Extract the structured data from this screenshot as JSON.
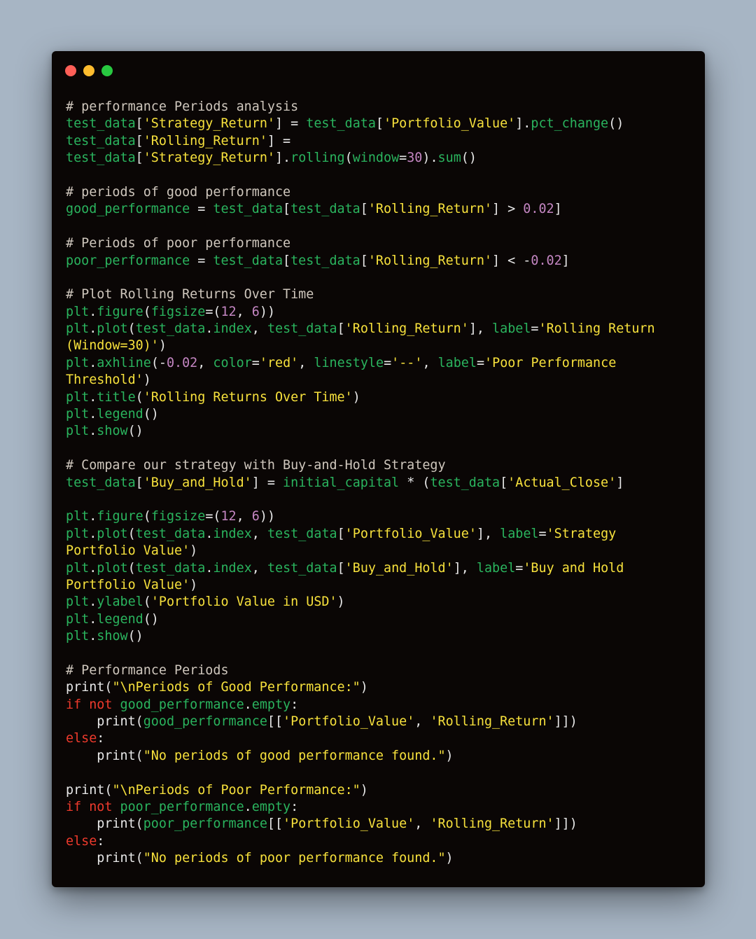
{
  "window": {
    "controls": [
      {
        "name": "close",
        "color": "#ff5f57"
      },
      {
        "name": "minimize",
        "color": "#febc2e"
      },
      {
        "name": "maximize",
        "color": "#28c840"
      }
    ]
  },
  "colors": {
    "background": "#a7b5c4",
    "editor_background": "#0a0605",
    "comment": "#cfc7bd",
    "identifier": "#2ab45e",
    "string": "#f7e13c",
    "number": "#c486c2",
    "keyword": "#ee3a2c",
    "plain": "#e8e8e8"
  },
  "code_lines": [
    [
      [
        "comment",
        "# performance Periods analysis"
      ]
    ],
    [
      [
        "ident",
        "test_data"
      ],
      [
        "plain",
        "["
      ],
      [
        "string",
        "'Strategy_Return'"
      ],
      [
        "plain",
        "] = "
      ],
      [
        "ident",
        "test_data"
      ],
      [
        "plain",
        "["
      ],
      [
        "string",
        "'Portfolio_Value'"
      ],
      [
        "plain",
        "]."
      ],
      [
        "ident",
        "pct_change"
      ],
      [
        "plain",
        "()"
      ]
    ],
    [
      [
        "ident",
        "test_data"
      ],
      [
        "plain",
        "["
      ],
      [
        "string",
        "'Rolling_Return'"
      ],
      [
        "plain",
        "] ="
      ]
    ],
    [
      [
        "ident",
        "test_data"
      ],
      [
        "plain",
        "["
      ],
      [
        "string",
        "'Strategy_Return'"
      ],
      [
        "plain",
        "]."
      ],
      [
        "ident",
        "rolling"
      ],
      [
        "plain",
        "("
      ],
      [
        "ident",
        "window"
      ],
      [
        "plain",
        "="
      ],
      [
        "number",
        "30"
      ],
      [
        "plain",
        ")."
      ],
      [
        "ident",
        "sum"
      ],
      [
        "plain",
        "()"
      ]
    ],
    [],
    [
      [
        "comment",
        "# periods of good performance"
      ]
    ],
    [
      [
        "ident",
        "good_performance"
      ],
      [
        "plain",
        " = "
      ],
      [
        "ident",
        "test_data"
      ],
      [
        "plain",
        "["
      ],
      [
        "ident",
        "test_data"
      ],
      [
        "plain",
        "["
      ],
      [
        "string",
        "'Rolling_Return'"
      ],
      [
        "plain",
        "] > "
      ],
      [
        "number",
        "0.02"
      ],
      [
        "plain",
        "]"
      ]
    ],
    [],
    [
      [
        "comment",
        "# Periods of poor performance"
      ]
    ],
    [
      [
        "ident",
        "poor_performance"
      ],
      [
        "plain",
        " = "
      ],
      [
        "ident",
        "test_data"
      ],
      [
        "plain",
        "["
      ],
      [
        "ident",
        "test_data"
      ],
      [
        "plain",
        "["
      ],
      [
        "string",
        "'Rolling_Return'"
      ],
      [
        "plain",
        "] < -"
      ],
      [
        "number",
        "0.02"
      ],
      [
        "plain",
        "]"
      ]
    ],
    [],
    [
      [
        "comment",
        "# Plot Rolling Returns Over Time"
      ]
    ],
    [
      [
        "ident",
        "plt"
      ],
      [
        "plain",
        "."
      ],
      [
        "ident",
        "figure"
      ],
      [
        "plain",
        "("
      ],
      [
        "ident",
        "figsize"
      ],
      [
        "plain",
        "=("
      ],
      [
        "number",
        "12"
      ],
      [
        "plain",
        ", "
      ],
      [
        "number",
        "6"
      ],
      [
        "plain",
        "))"
      ]
    ],
    [
      [
        "ident",
        "plt"
      ],
      [
        "plain",
        "."
      ],
      [
        "ident",
        "plot"
      ],
      [
        "plain",
        "("
      ],
      [
        "ident",
        "test_data"
      ],
      [
        "plain",
        "."
      ],
      [
        "ident",
        "index"
      ],
      [
        "plain",
        ", "
      ],
      [
        "ident",
        "test_data"
      ],
      [
        "plain",
        "["
      ],
      [
        "string",
        "'Rolling_Return'"
      ],
      [
        "plain",
        "], "
      ],
      [
        "ident",
        "label"
      ],
      [
        "plain",
        "="
      ],
      [
        "string",
        "'Rolling Return"
      ]
    ],
    [
      [
        "string",
        "(Window=30)'"
      ],
      [
        "plain",
        ")"
      ]
    ],
    [
      [
        "ident",
        "plt"
      ],
      [
        "plain",
        "."
      ],
      [
        "ident",
        "axhline"
      ],
      [
        "plain",
        "(-"
      ],
      [
        "number",
        "0.02"
      ],
      [
        "plain",
        ", "
      ],
      [
        "ident",
        "color"
      ],
      [
        "plain",
        "="
      ],
      [
        "string",
        "'red'"
      ],
      [
        "plain",
        ", "
      ],
      [
        "ident",
        "linestyle"
      ],
      [
        "plain",
        "="
      ],
      [
        "string",
        "'--'"
      ],
      [
        "plain",
        ", "
      ],
      [
        "ident",
        "label"
      ],
      [
        "plain",
        "="
      ],
      [
        "string",
        "'Poor Performance"
      ]
    ],
    [
      [
        "string",
        "Threshold'"
      ],
      [
        "plain",
        ")"
      ]
    ],
    [
      [
        "ident",
        "plt"
      ],
      [
        "plain",
        "."
      ],
      [
        "ident",
        "title"
      ],
      [
        "plain",
        "("
      ],
      [
        "string",
        "'Rolling Returns Over Time'"
      ],
      [
        "plain",
        ")"
      ]
    ],
    [
      [
        "ident",
        "plt"
      ],
      [
        "plain",
        "."
      ],
      [
        "ident",
        "legend"
      ],
      [
        "plain",
        "()"
      ]
    ],
    [
      [
        "ident",
        "plt"
      ],
      [
        "plain",
        "."
      ],
      [
        "ident",
        "show"
      ],
      [
        "plain",
        "()"
      ]
    ],
    [],
    [
      [
        "comment",
        "# Compare our strategy with Buy-and-Hold Strategy"
      ]
    ],
    [
      [
        "ident",
        "test_data"
      ],
      [
        "plain",
        "["
      ],
      [
        "string",
        "'Buy_and_Hold'"
      ],
      [
        "plain",
        "] = "
      ],
      [
        "ident",
        "initial_capital"
      ],
      [
        "plain",
        " * ("
      ],
      [
        "ident",
        "test_data"
      ],
      [
        "plain",
        "["
      ],
      [
        "string",
        "'Actual_Close'"
      ],
      [
        "plain",
        "]"
      ]
    ],
    [],
    [
      [
        "ident",
        "plt"
      ],
      [
        "plain",
        "."
      ],
      [
        "ident",
        "figure"
      ],
      [
        "plain",
        "("
      ],
      [
        "ident",
        "figsize"
      ],
      [
        "plain",
        "=("
      ],
      [
        "number",
        "12"
      ],
      [
        "plain",
        ", "
      ],
      [
        "number",
        "6"
      ],
      [
        "plain",
        "))"
      ]
    ],
    [
      [
        "ident",
        "plt"
      ],
      [
        "plain",
        "."
      ],
      [
        "ident",
        "plot"
      ],
      [
        "plain",
        "("
      ],
      [
        "ident",
        "test_data"
      ],
      [
        "plain",
        "."
      ],
      [
        "ident",
        "index"
      ],
      [
        "plain",
        ", "
      ],
      [
        "ident",
        "test_data"
      ],
      [
        "plain",
        "["
      ],
      [
        "string",
        "'Portfolio_Value'"
      ],
      [
        "plain",
        "], "
      ],
      [
        "ident",
        "label"
      ],
      [
        "plain",
        "="
      ],
      [
        "string",
        "'Strategy"
      ]
    ],
    [
      [
        "string",
        "Portfolio Value'"
      ],
      [
        "plain",
        ")"
      ]
    ],
    [
      [
        "ident",
        "plt"
      ],
      [
        "plain",
        "."
      ],
      [
        "ident",
        "plot"
      ],
      [
        "plain",
        "("
      ],
      [
        "ident",
        "test_data"
      ],
      [
        "plain",
        "."
      ],
      [
        "ident",
        "index"
      ],
      [
        "plain",
        ", "
      ],
      [
        "ident",
        "test_data"
      ],
      [
        "plain",
        "["
      ],
      [
        "string",
        "'Buy_and_Hold'"
      ],
      [
        "plain",
        "], "
      ],
      [
        "ident",
        "label"
      ],
      [
        "plain",
        "="
      ],
      [
        "string",
        "'Buy and Hold"
      ]
    ],
    [
      [
        "string",
        "Portfolio Value'"
      ],
      [
        "plain",
        ")"
      ]
    ],
    [
      [
        "ident",
        "plt"
      ],
      [
        "plain",
        "."
      ],
      [
        "ident",
        "ylabel"
      ],
      [
        "plain",
        "("
      ],
      [
        "string",
        "'Portfolio Value in USD'"
      ],
      [
        "plain",
        ")"
      ]
    ],
    [
      [
        "ident",
        "plt"
      ],
      [
        "plain",
        "."
      ],
      [
        "ident",
        "legend"
      ],
      [
        "plain",
        "()"
      ]
    ],
    [
      [
        "ident",
        "plt"
      ],
      [
        "plain",
        "."
      ],
      [
        "ident",
        "show"
      ],
      [
        "plain",
        "()"
      ]
    ],
    [],
    [
      [
        "comment",
        "# Performance Periods"
      ]
    ],
    [
      [
        "plain",
        "print("
      ],
      [
        "string",
        "\"\\nPeriods of Good Performance:\""
      ],
      [
        "plain",
        ")"
      ]
    ],
    [
      [
        "keyword",
        "if not "
      ],
      [
        "ident",
        "good_performance"
      ],
      [
        "plain",
        "."
      ],
      [
        "ident",
        "empty"
      ],
      [
        "plain",
        ":"
      ]
    ],
    [
      [
        "plain",
        "    print("
      ],
      [
        "ident",
        "good_performance"
      ],
      [
        "plain",
        "[["
      ],
      [
        "string",
        "'Portfolio_Value'"
      ],
      [
        "plain",
        ", "
      ],
      [
        "string",
        "'Rolling_Return'"
      ],
      [
        "plain",
        "]])"
      ]
    ],
    [
      [
        "keyword",
        "else"
      ],
      [
        "plain",
        ":"
      ]
    ],
    [
      [
        "plain",
        "    print("
      ],
      [
        "string",
        "\"No periods of good performance found.\""
      ],
      [
        "plain",
        ")"
      ]
    ],
    [],
    [
      [
        "plain",
        "print("
      ],
      [
        "string",
        "\"\\nPeriods of Poor Performance:\""
      ],
      [
        "plain",
        ")"
      ]
    ],
    [
      [
        "keyword",
        "if not "
      ],
      [
        "ident",
        "poor_performance"
      ],
      [
        "plain",
        "."
      ],
      [
        "ident",
        "empty"
      ],
      [
        "plain",
        ":"
      ]
    ],
    [
      [
        "plain",
        "    print("
      ],
      [
        "ident",
        "poor_performance"
      ],
      [
        "plain",
        "[["
      ],
      [
        "string",
        "'Portfolio_Value'"
      ],
      [
        "plain",
        ", "
      ],
      [
        "string",
        "'Rolling_Return'"
      ],
      [
        "plain",
        "]])"
      ]
    ],
    [
      [
        "keyword",
        "else"
      ],
      [
        "plain",
        ":"
      ]
    ],
    [
      [
        "plain",
        "    print("
      ],
      [
        "string",
        "\"No periods of poor performance found.\""
      ],
      [
        "plain",
        ")"
      ]
    ]
  ]
}
